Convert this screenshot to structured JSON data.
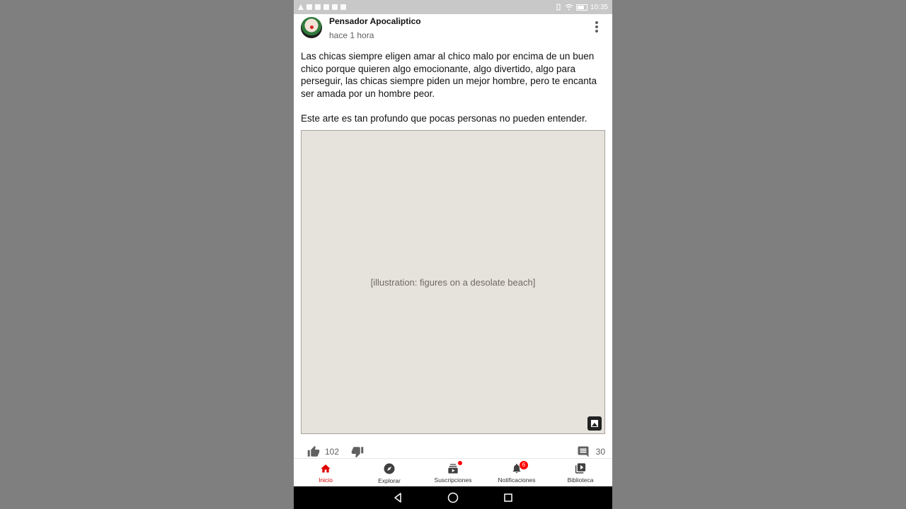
{
  "status_bar": {
    "time": "10:35"
  },
  "post": {
    "username": "Pensador Apocaliptico",
    "time_ago": "hace 1 hora",
    "paragraphs": [
      "Las chicas siempre eligen amar al chico malo por encima de un buen chico porque quieren algo emocionante, algo divertido, algo para perseguir, las chicas siempre piden un mejor hombre, pero te encanta ser amada por un hombre peor.",
      "Este arte es tan profundo que pocas personas no pueden entender."
    ],
    "likes": "102",
    "comments": "30"
  },
  "bottom_nav": [
    {
      "label": "Inicio",
      "icon": "home-icon",
      "active": true
    },
    {
      "label": "Explorar",
      "icon": "compass-icon"
    },
    {
      "label": "Suscripciones",
      "icon": "subscriptions-icon"
    },
    {
      "label": "Notificaciones",
      "icon": "bell-icon",
      "badge": "6"
    },
    {
      "label": "Biblioteca",
      "icon": "library-icon"
    }
  ],
  "colors": {
    "accent": "#e00000",
    "backdrop": "#7f7f7f"
  }
}
